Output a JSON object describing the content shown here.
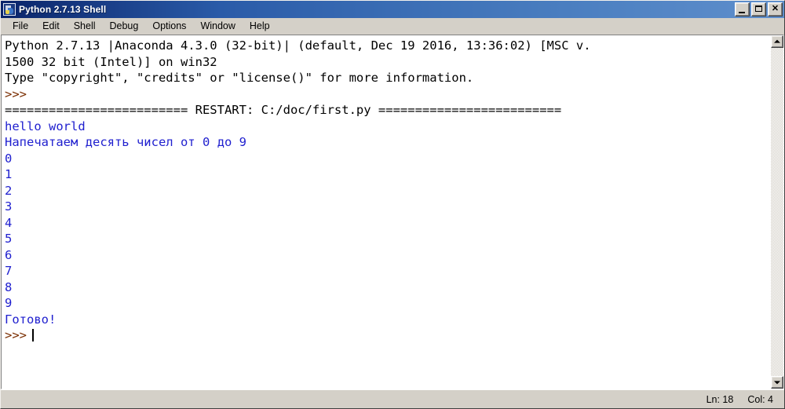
{
  "window": {
    "title": "Python 2.7.13 Shell",
    "icon": "python-logo-icon",
    "controls": {
      "minimize": "_",
      "maximize": "□",
      "close": "✕"
    }
  },
  "menubar": {
    "items": [
      {
        "label": "File"
      },
      {
        "label": "Edit"
      },
      {
        "label": "Shell"
      },
      {
        "label": "Debug"
      },
      {
        "label": "Options"
      },
      {
        "label": "Window"
      },
      {
        "label": "Help"
      }
    ]
  },
  "console": {
    "lines": [
      {
        "text": "Python 2.7.13 |Anaconda 4.3.0 (32-bit)| (default, Dec 19 2016, 13:36:02) [MSC v.",
        "color": "black"
      },
      {
        "text": "1500 32 bit (Intel)] on win32",
        "color": "black"
      },
      {
        "text": "Type \"copyright\", \"credits\" or \"license()\" for more information.",
        "color": "black"
      },
      {
        "text": ">>> ",
        "color": "prompt"
      },
      {
        "text": "========================= RESTART: C:/doc/first.py =========================",
        "color": "black"
      },
      {
        "text": "hello world",
        "color": "blue"
      },
      {
        "text": "Напечатаем десять чисел от 0 до 9",
        "color": "blue"
      },
      {
        "text": "0",
        "color": "blue"
      },
      {
        "text": "1",
        "color": "blue"
      },
      {
        "text": "2",
        "color": "blue"
      },
      {
        "text": "3",
        "color": "blue"
      },
      {
        "text": "4",
        "color": "blue"
      },
      {
        "text": "5",
        "color": "blue"
      },
      {
        "text": "6",
        "color": "blue"
      },
      {
        "text": "7",
        "color": "blue"
      },
      {
        "text": "8",
        "color": "blue"
      },
      {
        "text": "9",
        "color": "blue"
      },
      {
        "text": "Готово!",
        "color": "blue"
      },
      {
        "text": ">>>",
        "color": "prompt",
        "caret": true
      }
    ],
    "colors": {
      "output_blue": "#2020cf",
      "prompt_red": "#7a2d00",
      "stdout_black": "#000000",
      "background": "#ffffff"
    }
  },
  "scrollbar": {
    "up_arrow": "scroll-up-icon",
    "down_arrow": "scroll-down-icon"
  },
  "statusbar": {
    "line_label": "Ln: 18",
    "col_label": "Col: 4"
  }
}
